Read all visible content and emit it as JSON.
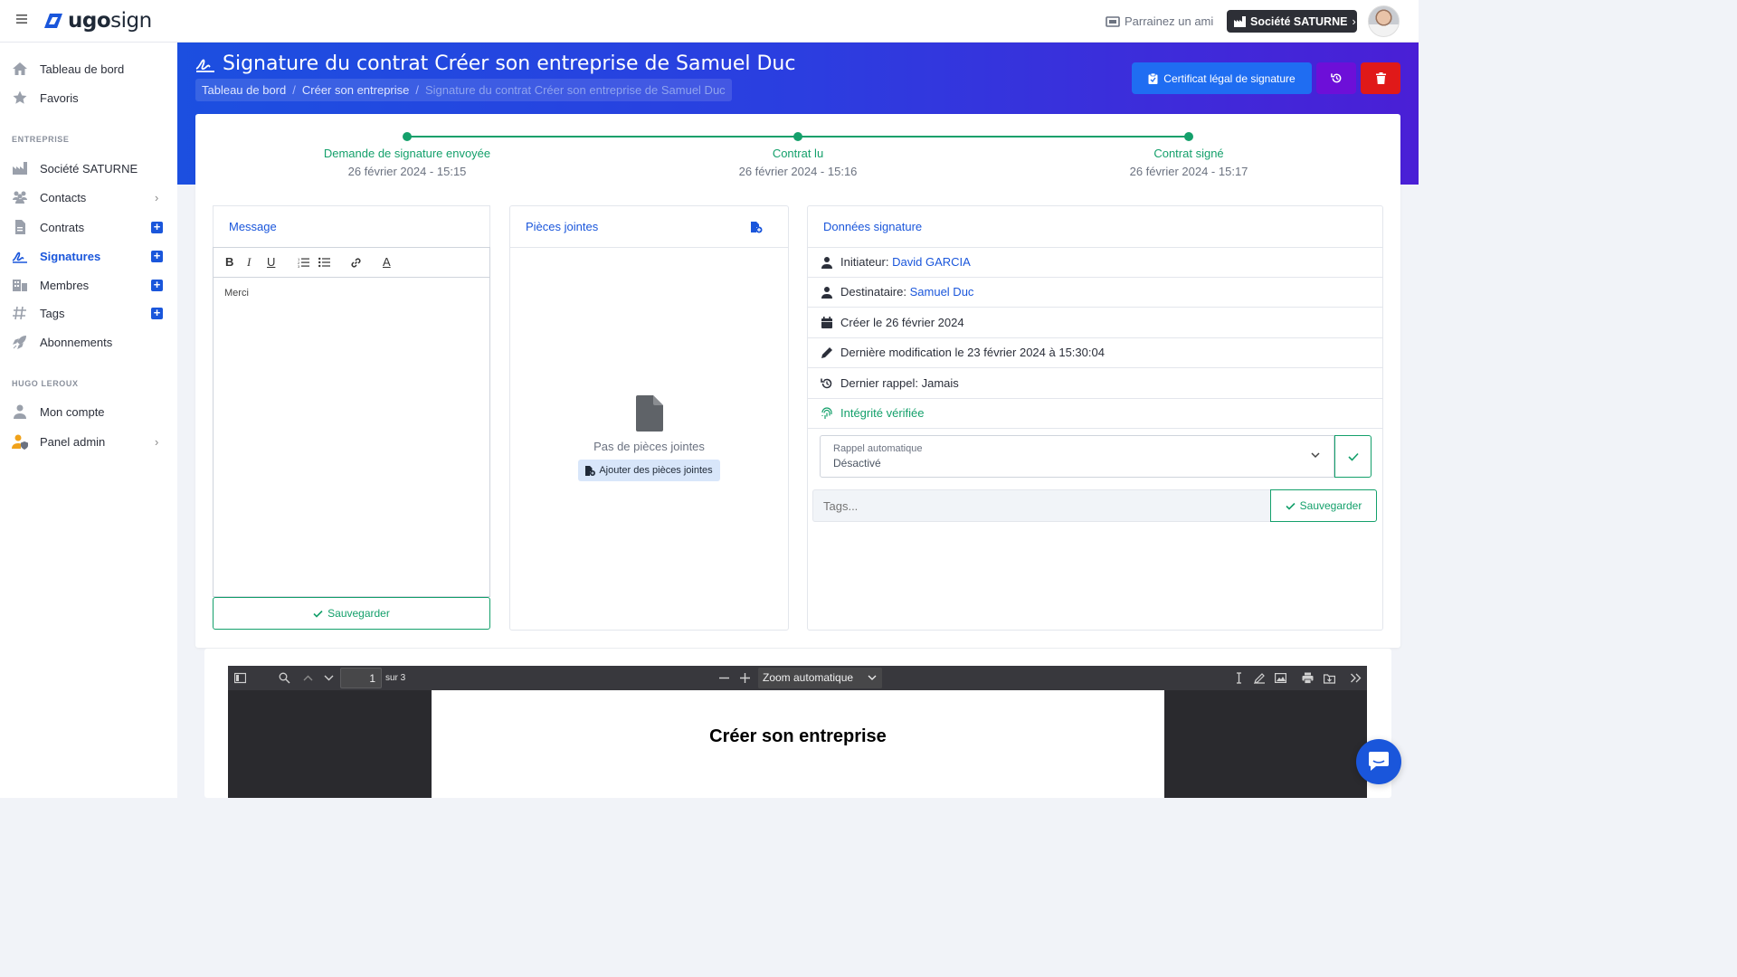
{
  "app": {
    "logo_bold": "ugo",
    "logo_light": "sign"
  },
  "topbar": {
    "refer_label": "Parrainez un ami",
    "company_label": "Société SATURNE",
    "company_chevron": "›"
  },
  "sidebar": {
    "items_top": [
      {
        "label": "Tableau de bord",
        "icon": "home-icon"
      },
      {
        "label": "Favoris",
        "icon": "star-icon"
      }
    ],
    "section_company": "ENTREPRISE",
    "items_company": [
      {
        "label": "Société SATURNE",
        "icon": "factory-icon"
      },
      {
        "label": "Contacts",
        "icon": "users-icon",
        "has_arrow": true
      },
      {
        "label": "Contrats",
        "icon": "document-icon",
        "has_plus": true
      },
      {
        "label": "Signatures",
        "icon": "signature-icon",
        "has_plus": true,
        "active": true
      },
      {
        "label": "Membres",
        "icon": "building-icon",
        "has_plus": true
      },
      {
        "label": "Tags",
        "icon": "hashtag-icon",
        "has_plus": true
      },
      {
        "label": "Abonnements",
        "icon": "rocket-icon"
      }
    ],
    "section_user": "HUGO LEROUX",
    "items_user": [
      {
        "label": "Mon compte",
        "icon": "user-icon"
      },
      {
        "label": "Panel admin",
        "icon": "user-shield-icon",
        "has_arrow": true
      }
    ],
    "plus_glyph": "+",
    "arrow_glyph": "›"
  },
  "header": {
    "title": "Signature du contrat Créer son entreprise de Samuel Duc",
    "breadcrumb": [
      "Tableau de bord",
      "Créer son entreprise",
      "Signature du contrat Créer son entreprise de Samuel Duc"
    ],
    "breadcrumb_sep": "/",
    "certificate_button": "Certificat légal de signature"
  },
  "timeline": [
    {
      "label": "Demande de signature envoyée",
      "date": "26 février 2024 - 15:15"
    },
    {
      "label": "Contrat lu",
      "date": "26 février 2024 - 15:16"
    },
    {
      "label": "Contrat signé",
      "date": "26 février 2024 - 15:17"
    }
  ],
  "message_panel": {
    "title": "Message",
    "body": "Merci",
    "save_label": "Sauvegarder",
    "toolbar": {
      "bold": "B",
      "italic": "I",
      "underline": "U",
      "color": "A"
    }
  },
  "attachments_panel": {
    "title": "Pièces jointes",
    "empty_text": "Pas de pièces jointes",
    "add_label": "Ajouter des pièces jointes"
  },
  "signature_data": {
    "title": "Données signature",
    "initiator_label": "Initiateur:",
    "initiator_value": "David GARCIA",
    "recipient_label": "Destinataire:",
    "recipient_value": "Samuel Duc",
    "created": "Créer le 26 février 2024",
    "modified": "Dernière modification le 23 février 2024 à 15:30:04",
    "last_reminder": "Dernier rappel: Jamais",
    "integrity": "Intégrité vérifiée",
    "auto_reminder_label": "Rappel automatique",
    "auto_reminder_value": "Désactivé",
    "tags_placeholder": "Tags...",
    "save_label": "Sauvegarder"
  },
  "pdf_viewer": {
    "page_current": "1",
    "page_total_label": "sur 3",
    "zoom_label": "Zoom automatique",
    "doc_title": "Créer son entreprise"
  },
  "colors": {
    "primary": "#1a56db",
    "success": "#14a06b",
    "danger": "#e01919",
    "purple": "#6d0fd8"
  }
}
